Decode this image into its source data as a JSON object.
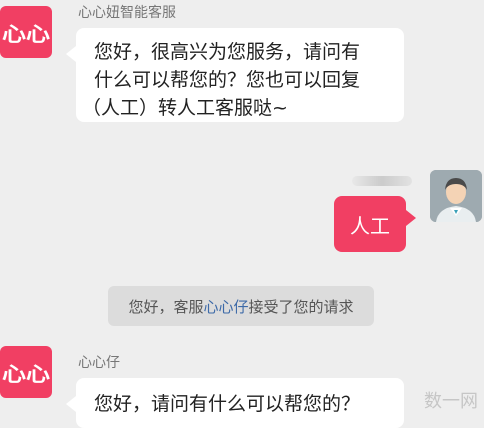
{
  "messages": [
    {
      "sender": "心心妞智能客服",
      "avatar_text": "心心",
      "text_lines": [
        "您好，很高兴为您服务，请问有",
        "什么可以帮您的？您也可以回复",
        "（人工）转人工客服哒~"
      ]
    },
    {
      "user_reply": "人工"
    },
    {
      "system_notice": {
        "prefix": "您好，客服",
        "agent": "心心仔",
        "suffix": "接受了您的请求"
      }
    },
    {
      "sender": "心心仔",
      "avatar_text": "心心",
      "text_lines": [
        "您好，请问有什么可以帮您的？"
      ]
    }
  ],
  "watermark": "数一网",
  "colors": {
    "brand": "#f13f63",
    "background": "#eeeeee",
    "link": "#3d6aa8"
  }
}
